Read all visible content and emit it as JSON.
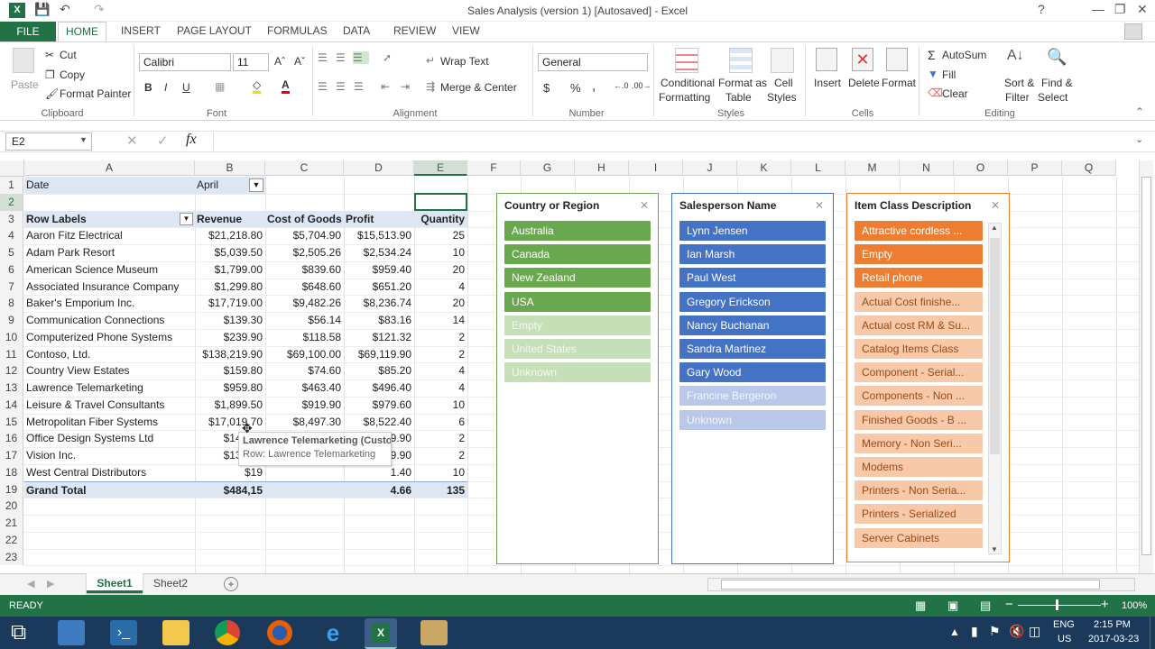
{
  "window": {
    "title": "Sales Analysis (version 1) [Autosaved] - Excel",
    "help": "?"
  },
  "tabs": {
    "file": "FILE",
    "home": "HOME",
    "insert": "INSERT",
    "page_layout": "PAGE LAYOUT",
    "formulas": "FORMULAS",
    "data": "DATA",
    "review": "REVIEW",
    "view": "VIEW"
  },
  "ribbon": {
    "clipboard": {
      "label": "Clipboard",
      "paste": "Paste",
      "cut": "Cut",
      "copy": "Copy",
      "format_painter": "Format Painter"
    },
    "font": {
      "label": "Font",
      "name": "Calibri",
      "size": "11",
      "bold": "B",
      "italic": "I",
      "underline": "U"
    },
    "alignment": {
      "label": "Alignment",
      "wrap": "Wrap Text",
      "merge": "Merge & Center"
    },
    "number": {
      "label": "Number",
      "format": "General",
      "currency": "$",
      "percent": "%",
      "comma": ","
    },
    "styles": {
      "label": "Styles",
      "cond1": "Conditional",
      "cond2": "Formatting",
      "fmt1": "Format as",
      "fmt2": "Table",
      "cell1": "Cell",
      "cell2": "Styles"
    },
    "cells": {
      "label": "Cells",
      "insert": "Insert",
      "delete": "Delete",
      "format": "Format"
    },
    "editing": {
      "label": "Editing",
      "autosum": "AutoSum",
      "fill": "Fill",
      "clear": "Clear",
      "sort1": "Sort &",
      "sort2": "Filter",
      "find1": "Find &",
      "find2": "Select"
    }
  },
  "formula_bar": {
    "name_box": "E2",
    "fx": "fx",
    "value": ""
  },
  "columns": [
    "A",
    "B",
    "C",
    "D",
    "E",
    "F",
    "G",
    "H",
    "I",
    "J",
    "K",
    "L",
    "M",
    "N",
    "O",
    "P",
    "Q"
  ],
  "rows": [
    "1",
    "2",
    "3",
    "4",
    "5",
    "6",
    "7",
    "8",
    "9",
    "10",
    "11",
    "12",
    "13",
    "14",
    "15",
    "16",
    "17",
    "18",
    "19",
    "20",
    "21",
    "22",
    "23"
  ],
  "pivot": {
    "filter_label": "Date",
    "filter_value": "April",
    "headers": [
      "Row Labels",
      "Revenue",
      "Cost of Goods",
      "Profit",
      "Quantity"
    ],
    "data": [
      [
        "Aaron Fitz Electrical",
        "$21,218.80",
        "$5,704.90",
        "$15,513.90",
        "25"
      ],
      [
        "Adam Park Resort",
        "$5,039.50",
        "$2,505.26",
        "$2,534.24",
        "10"
      ],
      [
        "American Science Museum",
        "$1,799.00",
        "$839.60",
        "$959.40",
        "20"
      ],
      [
        "Associated Insurance Company",
        "$1,299.80",
        "$648.60",
        "$651.20",
        "4"
      ],
      [
        "Baker's Emporium Inc.",
        "$17,719.00",
        "$9,482.26",
        "$8,236.74",
        "20"
      ],
      [
        "Communication Connections",
        "$139.30",
        "$56.14",
        "$83.16",
        "14"
      ],
      [
        "Computerized Phone Systems",
        "$239.90",
        "$118.58",
        "$121.32",
        "2"
      ],
      [
        "Contoso, Ltd.",
        "$138,219.90",
        "$69,100.00",
        "$69,119.90",
        "2"
      ],
      [
        "Country View Estates",
        "$159.80",
        "$74.60",
        "$85.20",
        "4"
      ],
      [
        "Lawrence Telemarketing",
        "$959.80",
        "$463.40",
        "$496.40",
        "4"
      ],
      [
        "Leisure & Travel Consultants",
        "$1,899.50",
        "$919.90",
        "$979.60",
        "10"
      ],
      [
        "Metropolitan Fiber Systems",
        "$17,019.70",
        "$8,497.30",
        "$8,522.40",
        "6"
      ],
      [
        "Office Design Systems Ltd",
        "$140,01",
        "",
        "9.90",
        "2"
      ],
      [
        "Vision Inc.",
        "$138,21",
        "",
        "9.90",
        "2"
      ],
      [
        "West Central Distributors",
        "$19",
        "",
        "1.40",
        "10"
      ]
    ],
    "total": [
      "Grand Total",
      "$484,15",
      "",
      "4.66",
      "135"
    ]
  },
  "tooltip": {
    "title": "Lawrence Telemarketing (Custo",
    "row": "Row: Lawrence Telemarketing"
  },
  "slicers": [
    {
      "title": "Country or Region",
      "items": [
        "Australia",
        "Canada",
        "New Zealand",
        "USA",
        "Empty",
        "United States",
        "Unknown"
      ],
      "selected": 4,
      "color": "#6aa84f",
      "light": "#c5dfb7"
    },
    {
      "title": "Salesperson Name",
      "items": [
        "Lynn Jensen",
        "Ian Marsh",
        "Paul West",
        "Gregory Erickson",
        "Nancy Buchanan",
        "Sandra Martinez",
        "Gary Wood",
        "Francine Bergeron",
        "Unknown"
      ],
      "selected": 7,
      "color": "#4472c4",
      "light": "#b9c8e8"
    },
    {
      "title": "Item Class Description",
      "items": [
        "Attractive cordless ...",
        "Empty",
        "Retail phone",
        "Actual Cost finishe...",
        "Actual cost RM & Su...",
        "Catalog Items Class",
        "Component - Serial...",
        "Components - Non ...",
        "Finished Goods - B ...",
        "Memory - Non Seri...",
        "Modems",
        "Printers - Non Seria...",
        "Printers - Serialized",
        "Server Cabinets"
      ],
      "selected": 3,
      "color": "#ed7d31",
      "light": "#f8c9a8"
    }
  ],
  "sheets": [
    "Sheet1",
    "Sheet2"
  ],
  "status": {
    "ready": "READY",
    "zoom": "100%"
  },
  "taskbar": {
    "lang1": "ENG",
    "lang2": "US",
    "time": "2:15 PM",
    "date": "2017-03-23"
  }
}
